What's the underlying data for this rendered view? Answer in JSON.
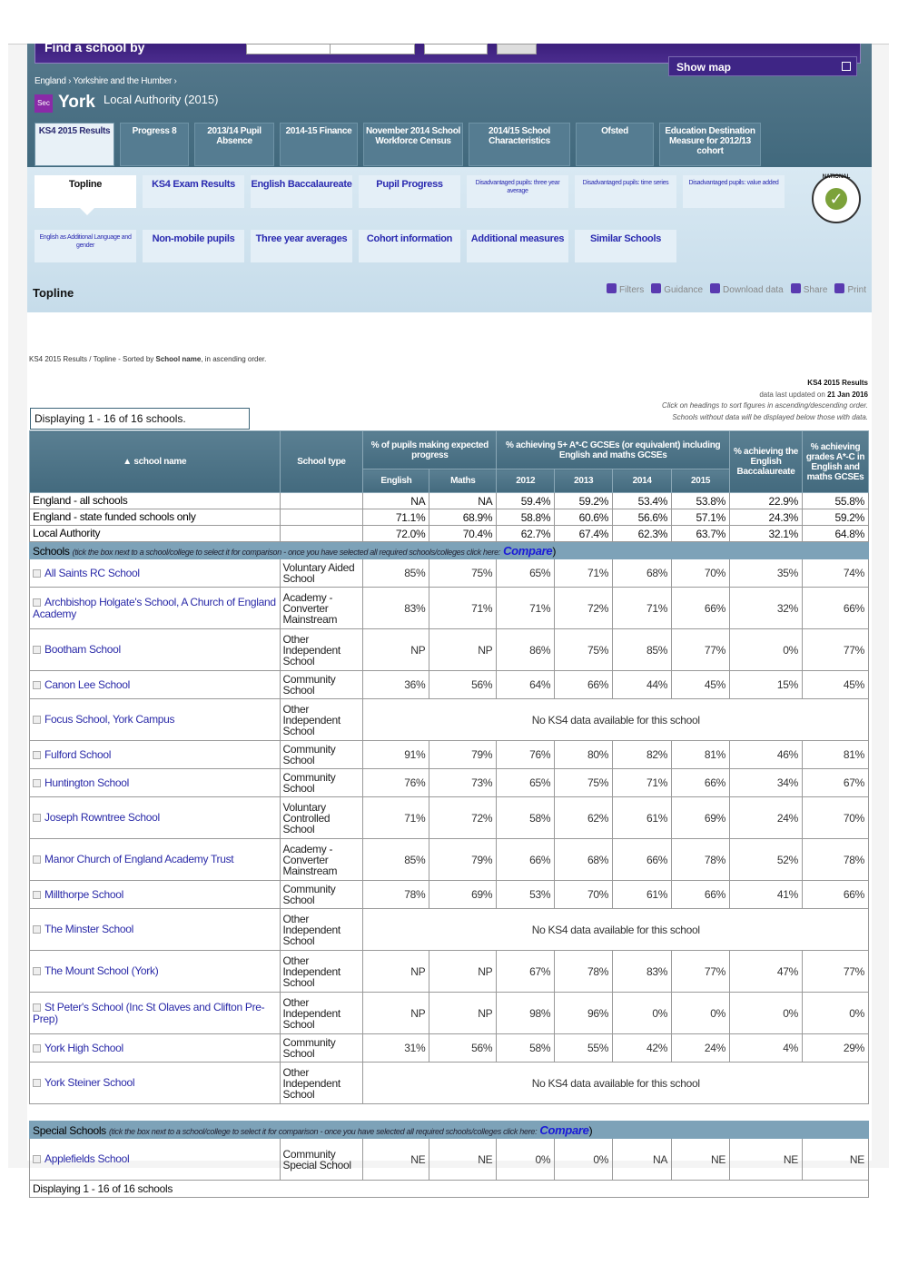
{
  "header": {
    "search_label": "Find a school by",
    "show_map": "Show map",
    "breadcrumb": [
      "England",
      "Yorkshire and the Humber"
    ],
    "phase_badge": "Sec",
    "title": "York",
    "subtitle": "Local Authority (2015)"
  },
  "main_tabs": [
    {
      "label": "KS4 2015 Results",
      "active": true
    },
    {
      "label": "Progress 8"
    },
    {
      "label": "2013/14 Pupil Absence"
    },
    {
      "label": "2014-15 Finance"
    },
    {
      "label": "November 2014 School Workforce Census"
    },
    {
      "label": "2014/15 School Characteristics"
    },
    {
      "label": "Ofsted"
    },
    {
      "label": "Education Destination Measure for 2012/13 cohort"
    }
  ],
  "sub_tabs": [
    {
      "label": "Topline",
      "active": true
    },
    {
      "label": "KS4 Exam Results"
    },
    {
      "label": "English Baccalaureate"
    },
    {
      "label": "Pupil Progress"
    },
    {
      "label": "Disadvantaged pupils: three year average",
      "small": true
    },
    {
      "label": "Disadvantaged pupils: time series",
      "small": true
    },
    {
      "label": "Disadvantaged pupils: value added",
      "small": true
    },
    {
      "label": "English as Additional Language and gender",
      "small": true
    },
    {
      "label": "Non-mobile pupils"
    },
    {
      "label": "Three year averages"
    },
    {
      "label": "Cohort information"
    },
    {
      "label": "Additional measures"
    },
    {
      "label": "Similar Schools"
    }
  ],
  "logo_text": "NATIONAL STATISTICS",
  "section_title": "Topline",
  "tools": [
    "Filters",
    "Guidance",
    "Download data",
    "Share",
    "Print"
  ],
  "sort_info": {
    "prefix": "KS4 2015 Results / Topline - Sorted by",
    "field": "School name",
    "suffix": ", in ascending order."
  },
  "meta": {
    "heading": "KS4 2015 Results",
    "updated_prefix": "data last updated on",
    "updated_date": "21 Jan 2016",
    "hint1": "Click on headings to sort figures in ascending/descending order.",
    "hint2": "Schools without data will be displayed below those with data."
  },
  "displaying_top": "Displaying 1 - 16 of 16 schools.",
  "displaying_bottom": "Displaying 1 - 16 of 16 schools",
  "table": {
    "headers": {
      "name": "▲ school name",
      "type": "School type",
      "progress": "% of pupils making expected progress",
      "five_ac": "% achieving 5+ A*-C GCSEs (or equivalent) including English and maths GCSEs",
      "ebacc": "% achieving the English Baccalaureate",
      "eng_maths": "% achieving grades A*-C in English and maths GCSEs",
      "english": "English",
      "maths": "Maths",
      "y2012": "2012",
      "y2013": "2013",
      "y2014": "2014",
      "y2015": "2015"
    },
    "summary": [
      {
        "name": "England - all schools",
        "values": [
          "NA",
          "NA",
          "59.4%",
          "59.2%",
          "53.4%",
          "53.8%",
          "22.9%",
          "55.8%"
        ]
      },
      {
        "name": "England - state funded schools only",
        "values": [
          "71.1%",
          "68.9%",
          "58.8%",
          "60.6%",
          "56.6%",
          "57.1%",
          "24.3%",
          "59.2%"
        ]
      },
      {
        "name": "Local Authority",
        "values": [
          "72.0%",
          "70.4%",
          "62.7%",
          "67.4%",
          "62.3%",
          "63.7%",
          "32.1%",
          "64.8%"
        ]
      }
    ],
    "schools_bar": {
      "label": "Schools",
      "hint": "(tick the box next to a school/college to select it for comparison - once you have selected all required schools/colleges click here:",
      "compare": "Compare"
    },
    "schools": [
      {
        "name": "All Saints RC School",
        "type": "Voluntary Aided School",
        "values": [
          "85%",
          "75%",
          "65%",
          "71%",
          "68%",
          "70%",
          "35%",
          "74%"
        ]
      },
      {
        "name": "Archbishop Holgate's School, A Church of England Academy",
        "type": "Academy - Converter Mainstream",
        "values": [
          "83%",
          "71%",
          "71%",
          "72%",
          "71%",
          "66%",
          "32%",
          "66%"
        ]
      },
      {
        "name": "Bootham School",
        "type": "Other Independent School",
        "values": [
          "NP",
          "NP",
          "86%",
          "75%",
          "85%",
          "77%",
          "0%",
          "77%"
        ]
      },
      {
        "name": "Canon Lee School",
        "type": "Community School",
        "values": [
          "36%",
          "56%",
          "64%",
          "66%",
          "44%",
          "45%",
          "15%",
          "45%"
        ]
      },
      {
        "name": "Focus School, York Campus",
        "type": "Other Independent School",
        "nodata": "No KS4 data available for this school"
      },
      {
        "name": "Fulford School",
        "type": "Community School",
        "values": [
          "91%",
          "79%",
          "76%",
          "80%",
          "82%",
          "81%",
          "46%",
          "81%"
        ]
      },
      {
        "name": "Huntington School",
        "type": "Community School",
        "values": [
          "76%",
          "73%",
          "65%",
          "75%",
          "71%",
          "66%",
          "34%",
          "67%"
        ]
      },
      {
        "name": "Joseph Rowntree School",
        "type": "Voluntary Controlled School",
        "values": [
          "71%",
          "72%",
          "58%",
          "62%",
          "61%",
          "69%",
          "24%",
          "70%"
        ]
      },
      {
        "name": "Manor Church of England Academy Trust",
        "type": "Academy - Converter Mainstream",
        "values": [
          "85%",
          "79%",
          "66%",
          "68%",
          "66%",
          "78%",
          "52%",
          "78%"
        ]
      },
      {
        "name": "Millthorpe School",
        "type": "Community School",
        "values": [
          "78%",
          "69%",
          "53%",
          "70%",
          "61%",
          "66%",
          "41%",
          "66%"
        ]
      },
      {
        "name": "The Minster School",
        "type": "Other Independent School",
        "nodata": "No KS4 data available for this school"
      },
      {
        "name": "The Mount School (York)",
        "type": "Other Independent School",
        "values": [
          "NP",
          "NP",
          "67%",
          "78%",
          "83%",
          "77%",
          "47%",
          "77%"
        ]
      },
      {
        "name": "St Peter's School (Inc St Olaves and Clifton Pre-Prep)",
        "type": "Other Independent School",
        "values": [
          "NP",
          "NP",
          "98%",
          "96%",
          "0%",
          "0%",
          "0%",
          "0%"
        ]
      },
      {
        "name": "York High School",
        "type": "Community School",
        "values": [
          "31%",
          "56%",
          "58%",
          "55%",
          "42%",
          "24%",
          "4%",
          "29%"
        ]
      },
      {
        "name": "York Steiner School",
        "type": "Other Independent School",
        "nodata": "No KS4 data available for this school"
      }
    ],
    "special_bar": {
      "label": "Special Schools",
      "hint": "(tick the box next to a school/college to select it for comparison - once you have selected all required schools/colleges click here:",
      "compare": "Compare"
    },
    "special": [
      {
        "name": "Applefields School",
        "type": "Community Special School",
        "values": [
          "NE",
          "NE",
          "0%",
          "0%",
          "NA",
          "NE",
          "NE",
          "NE"
        ]
      }
    ]
  }
}
